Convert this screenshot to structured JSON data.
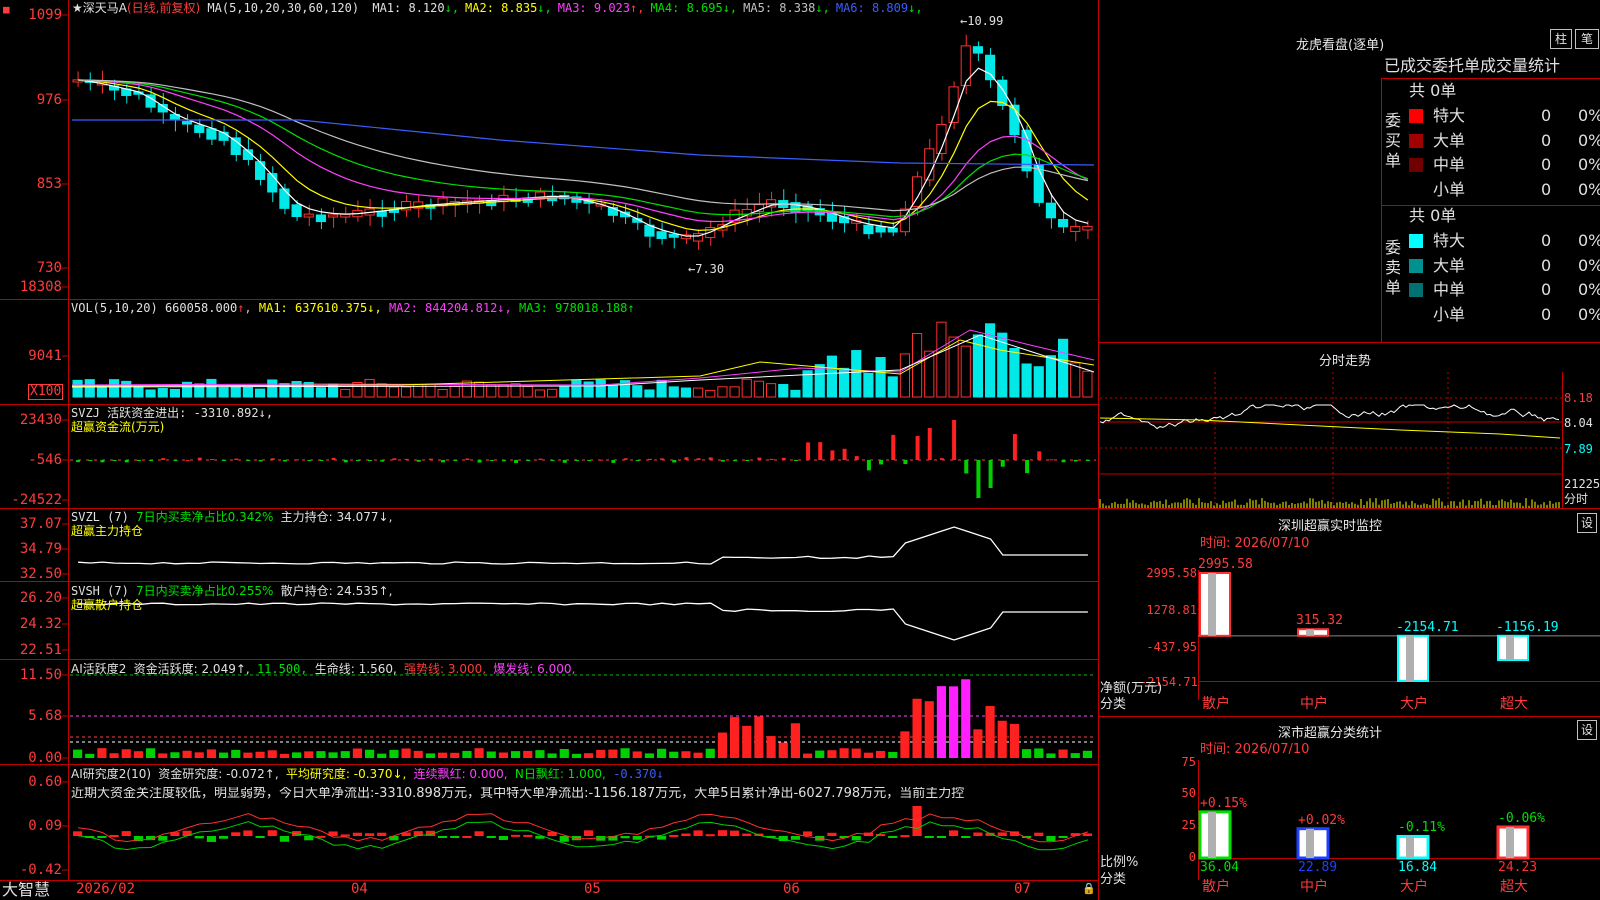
{
  "title_bar": {
    "stock": "★深天马A",
    "mode": "(日线,前复权)",
    "ma_params": "MA(5,10,20,30,60,120)",
    "ma": [
      {
        "label": "MA1:",
        "value": "8.120",
        "arrow": "↓",
        "color": "#e0e0e0"
      },
      {
        "label": "MA2:",
        "value": "8.835",
        "arrow": "↓",
        "color": "#ffff00"
      },
      {
        "label": "MA3:",
        "value": "9.023",
        "arrow": "↑",
        "color": "#ff40ff"
      },
      {
        "label": "MA4:",
        "value": "8.695",
        "arrow": "↓",
        "color": "#00e000"
      },
      {
        "label": "MA5:",
        "value": "8.338",
        "arrow": "↓",
        "color": "#c0c0c0"
      },
      {
        "label": "MA6:",
        "value": "8.809",
        "arrow": "↓",
        "color": "#3a5dff"
      }
    ]
  },
  "main": {
    "yticks": [
      "1099",
      "976",
      "853",
      "730"
    ],
    "high_label": "10.99",
    "low_label": "7.30"
  },
  "vol": {
    "label": "VOL(5,10,20)",
    "value": "660058.000",
    "arrow": "↑",
    "ma1": "MA1: 637610.375↓,",
    "ma2": "MA2: 844204.812↓,",
    "ma3": "MA3: 978018.188↑",
    "yticks": [
      "18308",
      "9041",
      "X100"
    ]
  },
  "svzj": {
    "line1": "SVZJ  活跃资金进出: -3310.892↓,",
    "line2": "超赢资金流(万元)",
    "yticks": [
      "23430",
      "-546",
      "-24522"
    ]
  },
  "svzl": {
    "prefix": "SVZL (7)",
    "text": "7日内买卖净占比0.342%",
    "hold": "主力持仓: 34.077↓,",
    "line2": "超赢主力持仓",
    "yticks": [
      "37.07",
      "34.79",
      "32.50"
    ]
  },
  "svsh": {
    "prefix": "SVSH (7)",
    "text": "7日内买卖净占比0.255%",
    "hold": "散户持仓: 24.535↑,",
    "line2": "超赢散户持仓",
    "yticks": [
      "26.20",
      "24.32",
      "22.51"
    ]
  },
  "ai1": {
    "prefix": "AI活跃度2",
    "value": "资金活跃度: 2.049↑,",
    "v2": "11.500,",
    "life": "生命线: 1.560,",
    "strong": "强势线: 3.000,",
    "burst": "爆发线: 6.000,",
    "yticks": [
      "11.50",
      "5.68",
      "0.00"
    ]
  },
  "ai2": {
    "prefix": "AI研究度2(10)",
    "value": "资金研究度: -0.072↑,",
    "avg": "平均研究度: -0.370↓,",
    "red1": "连续飘红: 0.000,",
    "red2": "N日飘红: 1.000,",
    "last": "-0.370↓",
    "comment": "近期大资金关注度较低，明显弱势，今日大单净流出:-3310.898万元，其中特大单净流出:-1156.187万元，大单5日累计净出-6027.798万元，当前主力控",
    "yticks": [
      "0.60",
      "0.09",
      "-0.42"
    ]
  },
  "xaxis": {
    "logo": "大智慧",
    "dates": [
      "2026/02",
      "04",
      "05",
      "06",
      "07"
    ]
  },
  "right": {
    "lhb_title": "龙虎看盘(逐单)",
    "btn_zhu": "柱",
    "btn_bi": "笔",
    "tabs": "已成交委托单成交量统计",
    "buy": {
      "side_label": "委买单",
      "total": "共 0单",
      "rows": [
        {
          "name": "特大",
          "count": "0",
          "pct": "0%",
          "color": "#ff0000"
        },
        {
          "name": "大单",
          "count": "0",
          "pct": "0%",
          "color": "#a00000"
        },
        {
          "name": "中单",
          "count": "0",
          "pct": "0%",
          "color": "#700000"
        },
        {
          "name": "小单",
          "count": "0",
          "pct": "0%",
          "color": ""
        }
      ]
    },
    "sell": {
      "side_label": "委卖单",
      "total": "共 0单",
      "rows": [
        {
          "name": "特大",
          "count": "0",
          "pct": "0%",
          "color": "#00ffff"
        },
        {
          "name": "大单",
          "count": "0",
          "pct": "0%",
          "color": "#009090"
        },
        {
          "name": "中单",
          "count": "0",
          "pct": "0%",
          "color": "#007070"
        },
        {
          "name": "小单",
          "count": "0",
          "pct": "0%",
          "color": ""
        }
      ]
    },
    "intraday": {
      "title": "分时走势",
      "yticks": [
        "8.18",
        "8.04",
        "7.89"
      ],
      "vol_tick": "21225",
      "unit": "分时"
    },
    "monitor": {
      "title": "深圳超赢实时监控",
      "btn": "设",
      "time": "时间: 2026/07/10",
      "yticks": [
        "2995.58",
        "1278.81",
        "-437.95",
        "-2154.71"
      ],
      "ylabel": "净额(万元)",
      "xlabel": "分类",
      "categories": [
        "散户",
        "中户",
        "大户",
        "超大"
      ],
      "value_labels": [
        "2995.58",
        "315.32",
        "-2154.71",
        "-1156.19"
      ]
    },
    "classify": {
      "title": "深市超赢分类统计",
      "btn": "设",
      "time": "时间: 2026/07/10",
      "yticks": [
        "75",
        "50",
        "25",
        "0"
      ],
      "ylabel": "比例%",
      "xlabel": "分类",
      "categories": [
        "散户",
        "中户",
        "大户",
        "超大"
      ],
      "change_labels": [
        "+0.15%",
        "+0.02%",
        "-0.11%",
        "-0.06%"
      ],
      "value_labels": [
        "36.04",
        "22.89",
        "16.84",
        "24.23"
      ]
    }
  },
  "chart_data": [
    {
      "type": "bar",
      "title": "深圳超赢实时监控",
      "categories": [
        "散户",
        "中户",
        "大户",
        "超大"
      ],
      "values": [
        2995.58,
        315.32,
        -2154.71,
        -1156.19
      ],
      "ylabel": "净额(万元)",
      "xlabel": "分类",
      "ylim": [
        -2154.71,
        2995.58
      ]
    },
    {
      "type": "bar",
      "title": "深市超赢分类统计",
      "categories": [
        "散户",
        "中户",
        "大户",
        "超大"
      ],
      "values": [
        36.04,
        22.89,
        16.84,
        24.23
      ],
      "changes": [
        "+0.15%",
        "+0.02%",
        "-0.11%",
        "-0.06%"
      ],
      "ylabel": "比例%",
      "xlabel": "分类",
      "ylim": [
        0,
        75
      ]
    }
  ]
}
